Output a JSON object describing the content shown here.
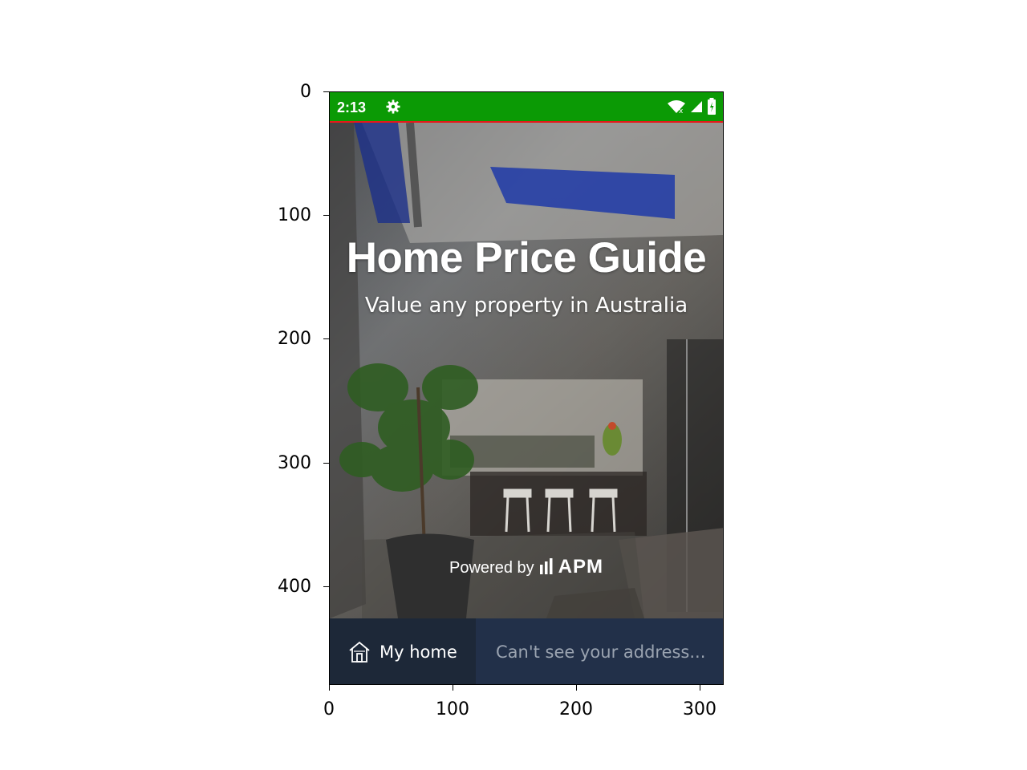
{
  "axes": {
    "y_ticks": [
      "0",
      "100",
      "200",
      "300",
      "400"
    ],
    "x_ticks": [
      "0",
      "100",
      "200",
      "300"
    ]
  },
  "status_bar": {
    "time": "2:13",
    "icons": [
      "settings-icon",
      "wifi-icon",
      "signal-icon",
      "battery-icon"
    ],
    "color": "#0b9a05"
  },
  "hero": {
    "title": "Home Price Guide",
    "subtitle": "Value any property in Australia",
    "powered_by": "Powered by",
    "brand": "APM"
  },
  "bottom_bar": {
    "my_home_label": "My home",
    "address_placeholder": "Can't see your address...",
    "color": "#223049"
  }
}
